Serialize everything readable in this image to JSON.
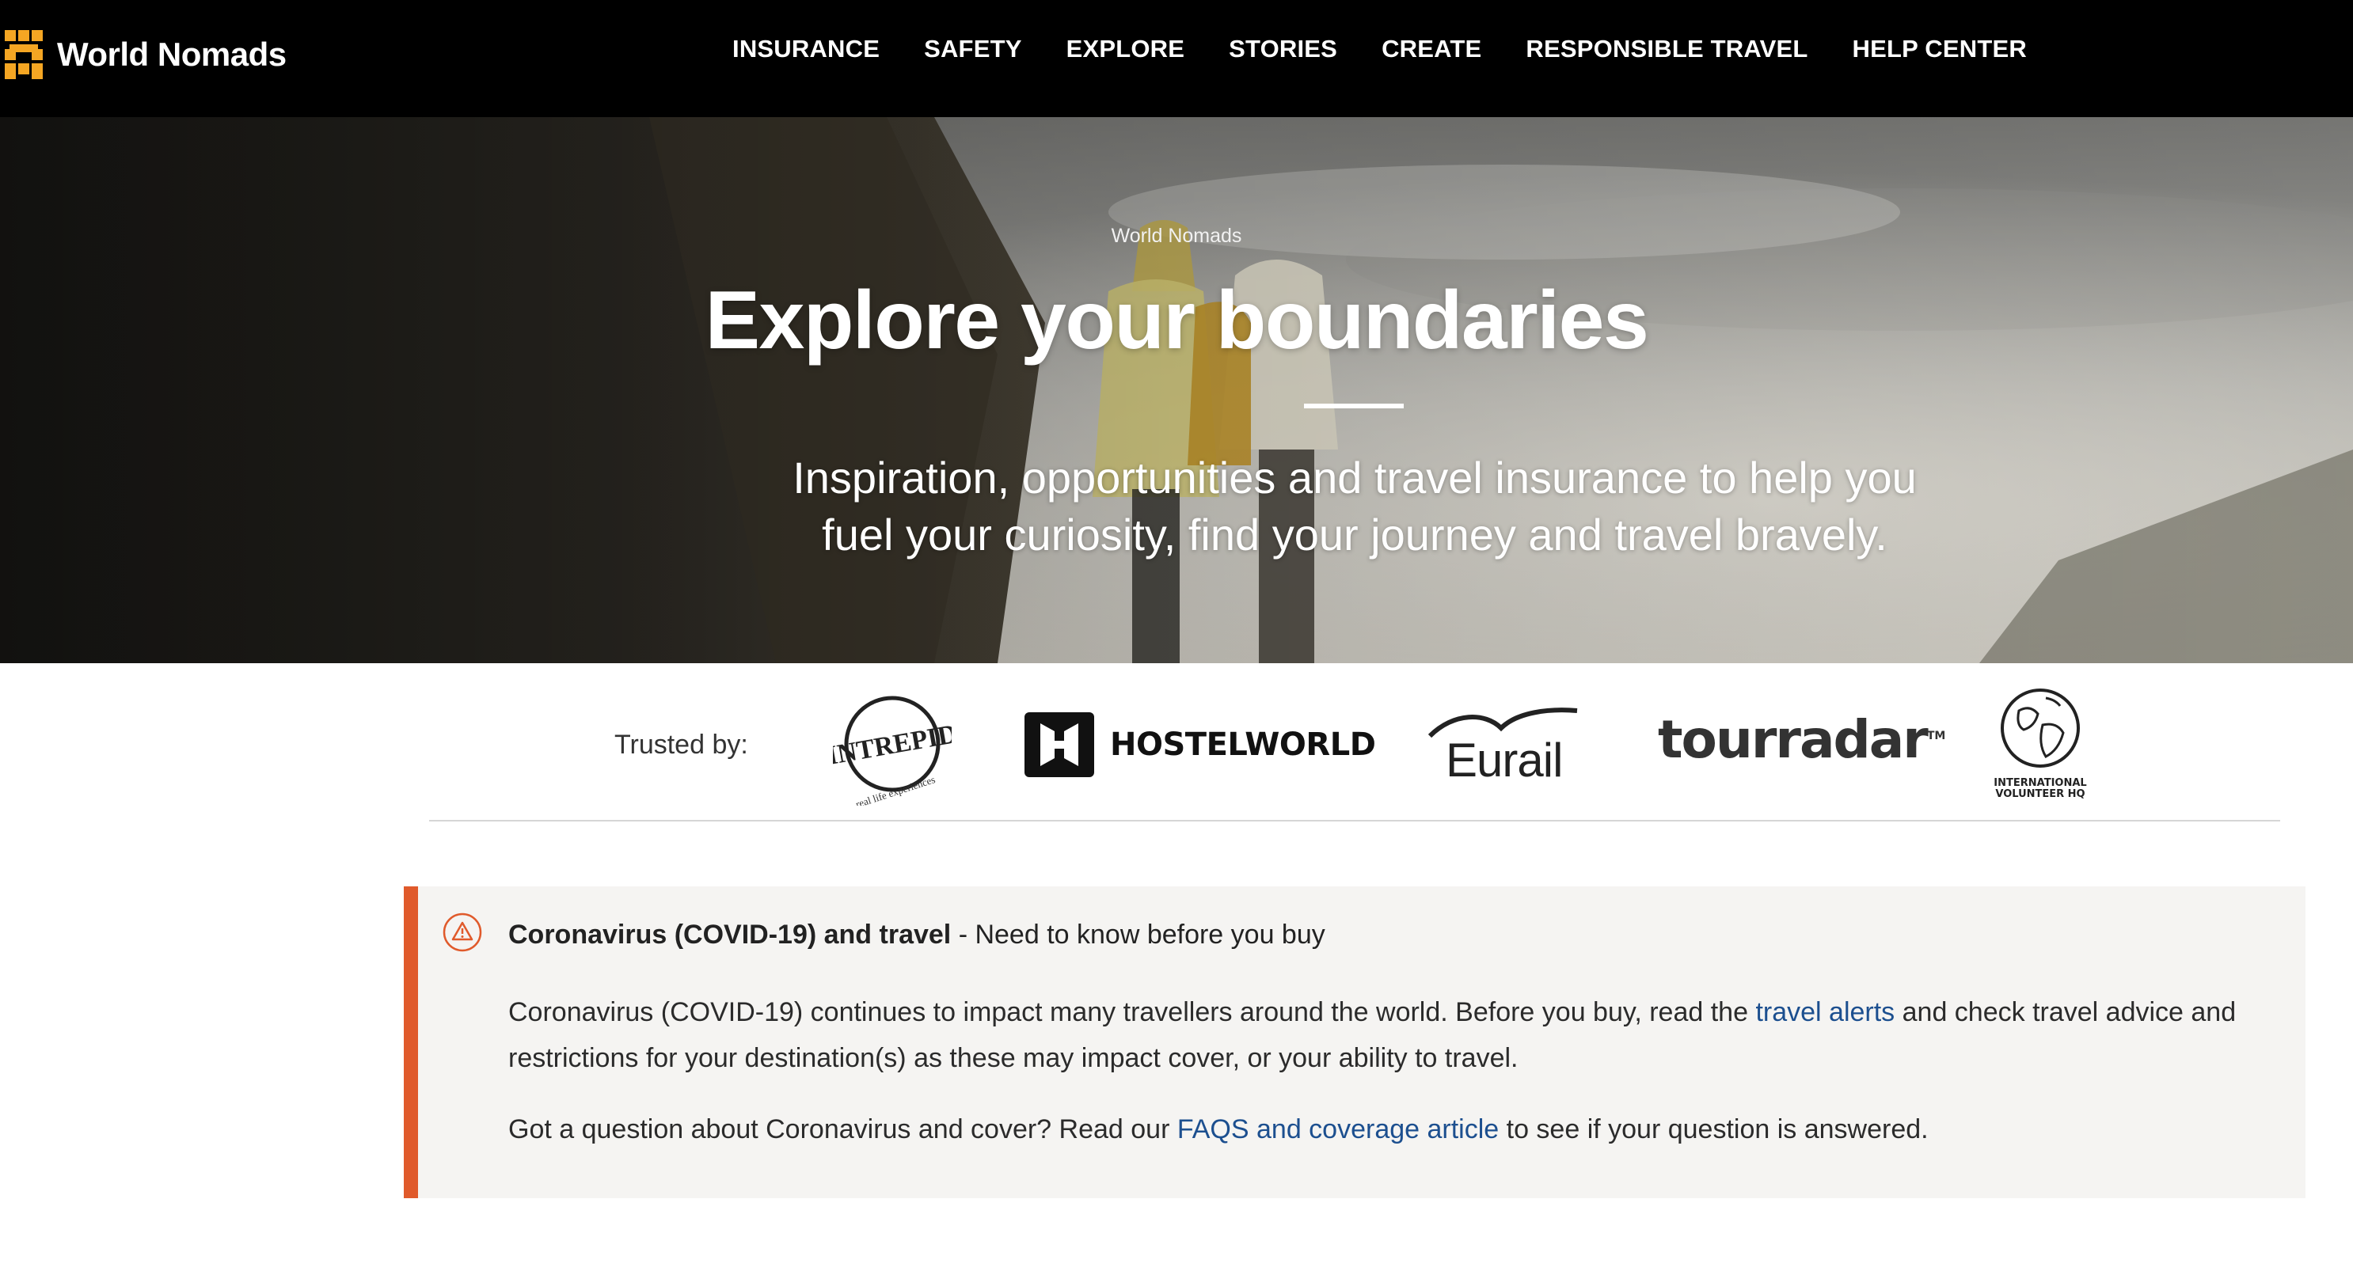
{
  "header": {
    "brand": "World Nomads",
    "nav": [
      {
        "label": "INSURANCE"
      },
      {
        "label": "SAFETY"
      },
      {
        "label": "EXPLORE"
      },
      {
        "label": "STORIES"
      },
      {
        "label": "CREATE"
      },
      {
        "label": "RESPONSIBLE TRAVEL"
      },
      {
        "label": "HELP CENTER"
      }
    ]
  },
  "hero": {
    "eyebrow": "World Nomads",
    "title": "Explore your boundaries",
    "subtitle_line1": "Inspiration, opportunities and travel insurance to help you",
    "subtitle_line2": "fuel your curiosity, find your journey and travel bravely."
  },
  "trusted": {
    "label": "Trusted by:",
    "partners": {
      "intrepid": "INTREPID",
      "intrepid_tagline": "real life experiences",
      "hostelworld": "HOSTELWORLD",
      "eurail": "Eurail",
      "tourradar": "tourradar",
      "tourradar_tm": "TM",
      "ivhq_line1": "INTERNATIONAL",
      "ivhq_line2": "VOLUNTEER HQ"
    }
  },
  "notice": {
    "title": "Coronavirus (COVID-19) and travel",
    "title_suffix": " - Need to know before you buy",
    "p1_before": "Coronavirus (COVID-19) continues to impact many travellers around the world. Before you buy, read the ",
    "p1_link": "travel alerts",
    "p1_after": " and check travel advice and restrictions for your destination(s) as these may impact cover, or your ability to travel.",
    "p2_before": "Got a question about Coronavirus and cover? Read our ",
    "p2_link": "FAQS and coverage article",
    "p2_after": " to see if your question is answered."
  },
  "colors": {
    "accent_orange": "#e05a2b",
    "brand_logo_orange": "#f5a623",
    "link_blue": "#1c4f8f",
    "notice_bg": "#f5f4f2"
  }
}
